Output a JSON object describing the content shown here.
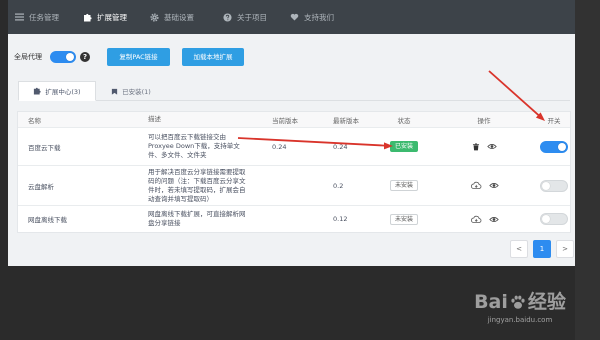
{
  "nav": {
    "items": [
      {
        "label": "任务管理",
        "icon": "list-icon",
        "active": false
      },
      {
        "label": "扩展管理",
        "icon": "puzzle-icon",
        "active": true
      },
      {
        "label": "基础设置",
        "icon": "gear-icon",
        "active": false
      },
      {
        "label": "关于项目",
        "icon": "help-circle-icon",
        "active": false
      },
      {
        "label": "支持我们",
        "icon": "heart-icon",
        "active": false
      }
    ]
  },
  "toolbar": {
    "global_proxy_label": "全局代理",
    "global_proxy_enabled": true,
    "help_glyph": "?",
    "copy_pac_label": "复制PAC链接",
    "load_local_label": "加载本地扩展"
  },
  "tabs": [
    {
      "label": "扩展中心(3)",
      "icon": "extension-center-icon",
      "active": true
    },
    {
      "label": "已安装(1)",
      "icon": "installed-icon",
      "active": false
    }
  ],
  "table": {
    "headers": {
      "name": "名称",
      "description": "描述",
      "current_version": "当前版本",
      "latest_version": "最新版本",
      "status": "状态",
      "actions": "操作",
      "switch": "开关"
    },
    "rows": [
      {
        "name": "百度云下载",
        "description": "可以把百度云下载链接交由Proxyee Down下载，支持单文件、多文件、文件夹",
        "current_version": "0.24",
        "latest_version": "0.24",
        "status": "已安装",
        "installed": true,
        "actions": [
          "trash-icon",
          "eye-icon"
        ],
        "enabled": true
      },
      {
        "name": "云盘解析",
        "description": "用于解决百度云分享链接需要提取码的问题（注：下载百度云分享文件时，若未填写提取码，扩展会自动查询并填写提取码）",
        "current_version": "",
        "latest_version": "0.2",
        "status": "未安装",
        "installed": false,
        "actions": [
          "cloud-download-icon",
          "eye-icon"
        ],
        "enabled": false
      },
      {
        "name": "网盘离线下载",
        "description": "网盘离线下载扩展，可直接解析网盘分享链接",
        "current_version": "",
        "latest_version": "0.12",
        "status": "未安装",
        "installed": false,
        "actions": [
          "cloud-download-icon",
          "eye-icon"
        ],
        "enabled": false
      }
    ]
  },
  "pagination": {
    "prev": "<",
    "current_page": "1",
    "next": ">"
  },
  "watermark": {
    "logo_left": "Bai",
    "logo_right": "经验",
    "url": "jingyan.baidu.com"
  },
  "colors": {
    "accent": "#2d8cf0",
    "button": "#2f9ee3",
    "success": "#3cba6f",
    "annotation": "#d9342b",
    "nav_bg": "#3d4349"
  }
}
